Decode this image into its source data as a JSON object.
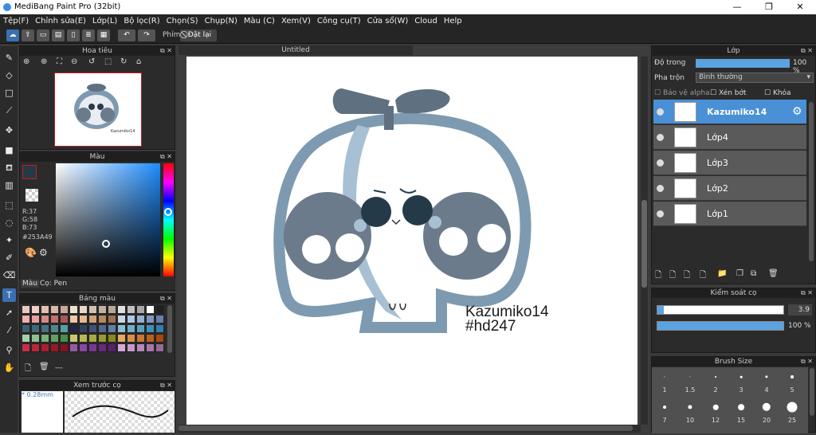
{
  "app": {
    "title": "MediBang Paint Pro (32bit)"
  },
  "menu": [
    "Tệp(F)",
    "Chỉnh sửa(E)",
    "Lớp(L)",
    "Bộ lọc(R)",
    "Chọn(S)",
    "Chụp(N)",
    "Màu (C)",
    "Xem(V)",
    "Công cụ(T)",
    "Cửa sổ(W)",
    "Cloud",
    "Help"
  ],
  "toolbar": {
    "shortcut_label": "Phím",
    "reset_label": "Đặt lại"
  },
  "panels": {
    "navigator": "Hoa tiêu",
    "color": "Màu",
    "color_tabs": [
      "Màu",
      "Cọ: Pen"
    ],
    "palette": "Bảng màu",
    "brush_preview": "Xem trước cọ",
    "layer": "Lớp",
    "brush_control": "Kiểm soát cọ",
    "brush_size": "Brush Size"
  },
  "color": {
    "r": "R:37",
    "g": "G:58",
    "b": "B:73",
    "hex": "#253A49",
    "current": "#253a49"
  },
  "palette_more": "---",
  "brush_preview": {
    "size": "0.28mm"
  },
  "canvas": {
    "tab": "Untitled",
    "signature_name": "Kazumiko14",
    "signature_tag": "#hd247"
  },
  "layer_panel": {
    "opacity_label": "Độ trong",
    "opacity_value": "100 %",
    "blend_label": "Pha trộn",
    "blend_value": "Bình thường",
    "protect_alpha": "Bảo vệ alpha",
    "clipping": "Xén bớt",
    "lock": "Khóa",
    "layers": [
      "Kazumiko14",
      "Lớp4",
      "Lớp3",
      "Lớp2",
      "Lớp1"
    ]
  },
  "brush_control": {
    "size_value": "3.9",
    "opacity_value": "100 %"
  },
  "brush_sizes": [
    "1",
    "1.5",
    "2",
    "3",
    "4",
    "5",
    "7",
    "10",
    "12",
    "15",
    "20",
    "25"
  ],
  "palette_colors": [
    "#e8c8c0",
    "#f0d0c8",
    "#e0c0b0",
    "#d8b8a8",
    "#c8a898",
    "#f0e0d0",
    "#e8d8c8",
    "#d0c0b0",
    "#c0b0a0",
    "#b8a898",
    "#e0e0e0",
    "#c0c0c0",
    "#a8a8a8",
    "#ffffff",
    "#202020",
    "#f0b0b0",
    "#e8a0a0",
    "#d88888",
    "#c07070",
    "#a85858",
    "#f0c8a8",
    "#e8b890",
    "#d0a078",
    "#b88860",
    "#a07050",
    "#c8d8e8",
    "#b0c8e0",
    "#98b0d0",
    "#8098c0",
    "#6880b0",
    "#3a6070",
    "#406878",
    "#487080",
    "#508890",
    "#58a0a8",
    "#202840",
    "#304060",
    "#405078",
    "#506890",
    "#6080a8",
    "#88c0d0",
    "#70b0c8",
    "#58a0c0",
    "#4090b8",
    "#3080b0",
    "#a8d0a8",
    "#90c090",
    "#78b078",
    "#60a060",
    "#489048",
    "#c8c870",
    "#b8b858",
    "#a8a840",
    "#989830",
    "#888820",
    "#e8a860",
    "#d89048",
    "#c87830",
    "#b86020",
    "#a84810",
    "#c83048",
    "#b82838",
    "#a82030",
    "#981828",
    "#881020",
    "#9858a8",
    "#8848a0",
    "#783890",
    "#682880",
    "#582070",
    "#d8a8d8",
    "#c898c8",
    "#b888b8",
    "#a878a8",
    "#986898"
  ]
}
